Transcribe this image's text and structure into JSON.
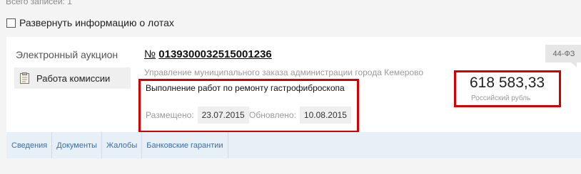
{
  "records": {
    "label": "Всего записей: 1"
  },
  "expand": {
    "label": "Развернуть информацию о лотах",
    "checked": false
  },
  "lot": {
    "procedure_type": "Электронный аукцион",
    "commission_status": "Работа комиссии",
    "number_prefix": "№",
    "number": "0139300032515001236",
    "customer": "Управление муниципального заказа администрации города Кемерово",
    "subject": "Выполнение работ по ремонту гастрофиброскопа",
    "placed_label": "Размещено:",
    "placed_date": "23.07.2015",
    "updated_label": "Обновлено:",
    "updated_date": "10.08.2015",
    "price": "618 583,33",
    "currency": "Российский рубль",
    "law": "44-ФЗ"
  },
  "tabs": [
    {
      "label": "Сведения"
    },
    {
      "label": "Документы"
    },
    {
      "label": "Жалобы"
    },
    {
      "label": "Банковские гарантии"
    }
  ],
  "colors": {
    "highlight": "#d40000",
    "link": "#3a6ea5",
    "tabs_background": "#e7eff7"
  },
  "icons": {
    "commission": "clipboard-icon"
  }
}
